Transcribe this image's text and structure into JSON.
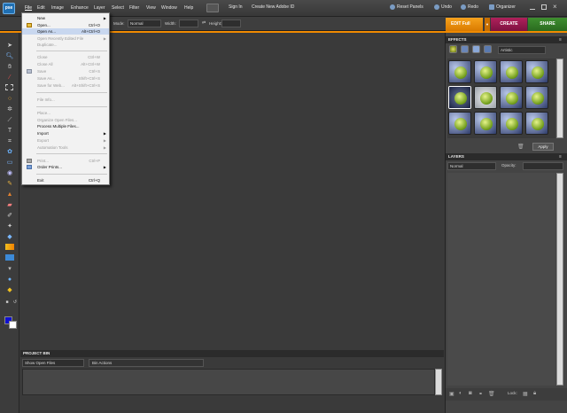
{
  "app": {
    "logo": "pse"
  },
  "menubar": {
    "items": [
      "File",
      "Edit",
      "Image",
      "Enhance",
      "Layer",
      "Select",
      "Filter",
      "View",
      "Window",
      "Help"
    ],
    "sign_in": "Sign In",
    "create_id": "Create New Adobe ID",
    "reset_panels": "Reset Panels",
    "undo": "Undo",
    "redo": "Redo",
    "organizer": "Organizer"
  },
  "tabs": {
    "edit": "EDIT Full",
    "create": "CREATE",
    "share": "SHARE"
  },
  "options_bar": {
    "mode_label": "Mode:",
    "mode_value": "Normal",
    "width_label": "Width:",
    "height_label": "Height:"
  },
  "file_menu": {
    "items": [
      {
        "label": "New",
        "shortcut": "",
        "submenu": true,
        "enabled": true
      },
      {
        "label": "Open...",
        "shortcut": "Ctrl+O",
        "submenu": false,
        "enabled": true
      },
      {
        "label": "Open As...",
        "shortcut": "Alt+Ctrl+O",
        "submenu": false,
        "enabled": true,
        "highlighted": true
      },
      {
        "label": "Open Recently Edited File",
        "shortcut": "",
        "submenu": true,
        "enabled": false
      },
      {
        "label": "Duplicate...",
        "shortcut": "",
        "submenu": false,
        "enabled": false
      },
      {
        "label": "Close",
        "shortcut": "Ctrl+W",
        "submenu": false,
        "enabled": false
      },
      {
        "label": "Close All",
        "shortcut": "Alt+Ctrl+W",
        "submenu": false,
        "enabled": false
      },
      {
        "label": "Save",
        "shortcut": "Ctrl+S",
        "submenu": false,
        "enabled": false
      },
      {
        "label": "Save As...",
        "shortcut": "Shift+Ctrl+S",
        "submenu": false,
        "enabled": false
      },
      {
        "label": "Save for Web...",
        "shortcut": "Alt+Shift+Ctrl+S",
        "submenu": false,
        "enabled": false
      },
      {
        "label": "File Info...",
        "shortcut": "",
        "submenu": false,
        "enabled": false
      },
      {
        "label": "Place...",
        "shortcut": "",
        "submenu": false,
        "enabled": false
      },
      {
        "label": "Organize Open Files...",
        "shortcut": "",
        "submenu": false,
        "enabled": false
      },
      {
        "label": "Process Multiple Files...",
        "shortcut": "",
        "submenu": false,
        "enabled": true
      },
      {
        "label": "Import",
        "shortcut": "",
        "submenu": true,
        "enabled": true
      },
      {
        "label": "Export",
        "shortcut": "",
        "submenu": true,
        "enabled": false
      },
      {
        "label": "Automation Tools",
        "shortcut": "",
        "submenu": true,
        "enabled": false
      },
      {
        "label": "Print...",
        "shortcut": "Ctrl+P",
        "submenu": false,
        "enabled": false
      },
      {
        "label": "Order Prints...",
        "shortcut": "",
        "submenu": true,
        "enabled": true
      },
      {
        "label": "Exit",
        "shortcut": "Ctrl+Q",
        "submenu": false,
        "enabled": true
      }
    ]
  },
  "project_bin": {
    "title": "PROJECT BIN",
    "show": "Show Open Files",
    "actions": "Bin Actions"
  },
  "effects": {
    "title": "EFFECTS",
    "filter": "Artistic",
    "apply": "Apply"
  },
  "layers": {
    "title": "LAYERS",
    "blend": "Normal",
    "opacity_label": "Opacity:",
    "lock_label": "Lock:"
  },
  "colors": {
    "accent": "#f08a00",
    "create": "#9b1a4f",
    "share": "#3a7f2a",
    "foreground": "#1010d0",
    "background": "#ffffff"
  }
}
